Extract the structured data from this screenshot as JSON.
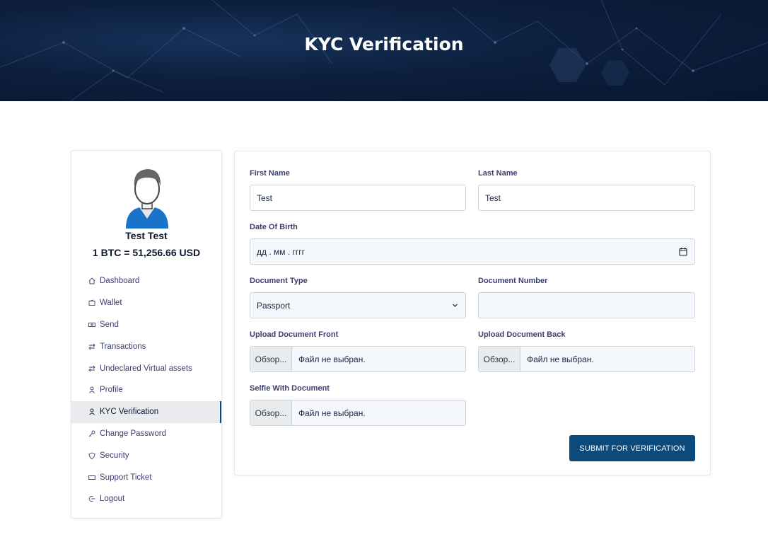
{
  "header": {
    "title": "KYC Verification"
  },
  "user": {
    "name": "Test Test",
    "btc_rate": "1 BTC = 51,256.66 USD"
  },
  "sidebar": {
    "items": [
      {
        "label": "Dashboard",
        "icon": "home-icon"
      },
      {
        "label": "Wallet",
        "icon": "wallet-icon"
      },
      {
        "label": "Send",
        "icon": "money-icon"
      },
      {
        "label": "Transactions",
        "icon": "transfer-icon"
      },
      {
        "label": "Undeclared Virtual assets",
        "icon": "transfer-icon"
      },
      {
        "label": "Profile",
        "icon": "user-icon"
      },
      {
        "label": "KYC Verification",
        "icon": "user-icon",
        "active": true
      },
      {
        "label": "Change Password",
        "icon": "key-icon"
      },
      {
        "label": "Security",
        "icon": "shield-icon"
      },
      {
        "label": "Support Ticket",
        "icon": "ticket-icon"
      },
      {
        "label": "Logout",
        "icon": "logout-icon"
      }
    ]
  },
  "form": {
    "first_name": {
      "label": "First Name",
      "value": "Test"
    },
    "last_name": {
      "label": "Last Name",
      "value": "Test"
    },
    "dob": {
      "label": "Date Of Birth",
      "value": "дд . мм . гггг"
    },
    "doc_type": {
      "label": "Document Type",
      "value": "Passport"
    },
    "doc_number": {
      "label": "Document Number",
      "value": ""
    },
    "upload_front": {
      "label": "Upload Document Front",
      "button": "Обзор...",
      "status": "Файл не выбран."
    },
    "upload_back": {
      "label": "Upload Document Back",
      "button": "Обзор...",
      "status": "Файл не выбран."
    },
    "selfie": {
      "label": "Selfie With Document",
      "button": "Обзор...",
      "status": "Файл не выбран."
    },
    "submit_label": "SUBMIT FOR VERIFICATION"
  },
  "colors": {
    "primary": "#0c4a7c",
    "hero_bg": "#0c1f3d",
    "label": "#3b3f6e"
  }
}
